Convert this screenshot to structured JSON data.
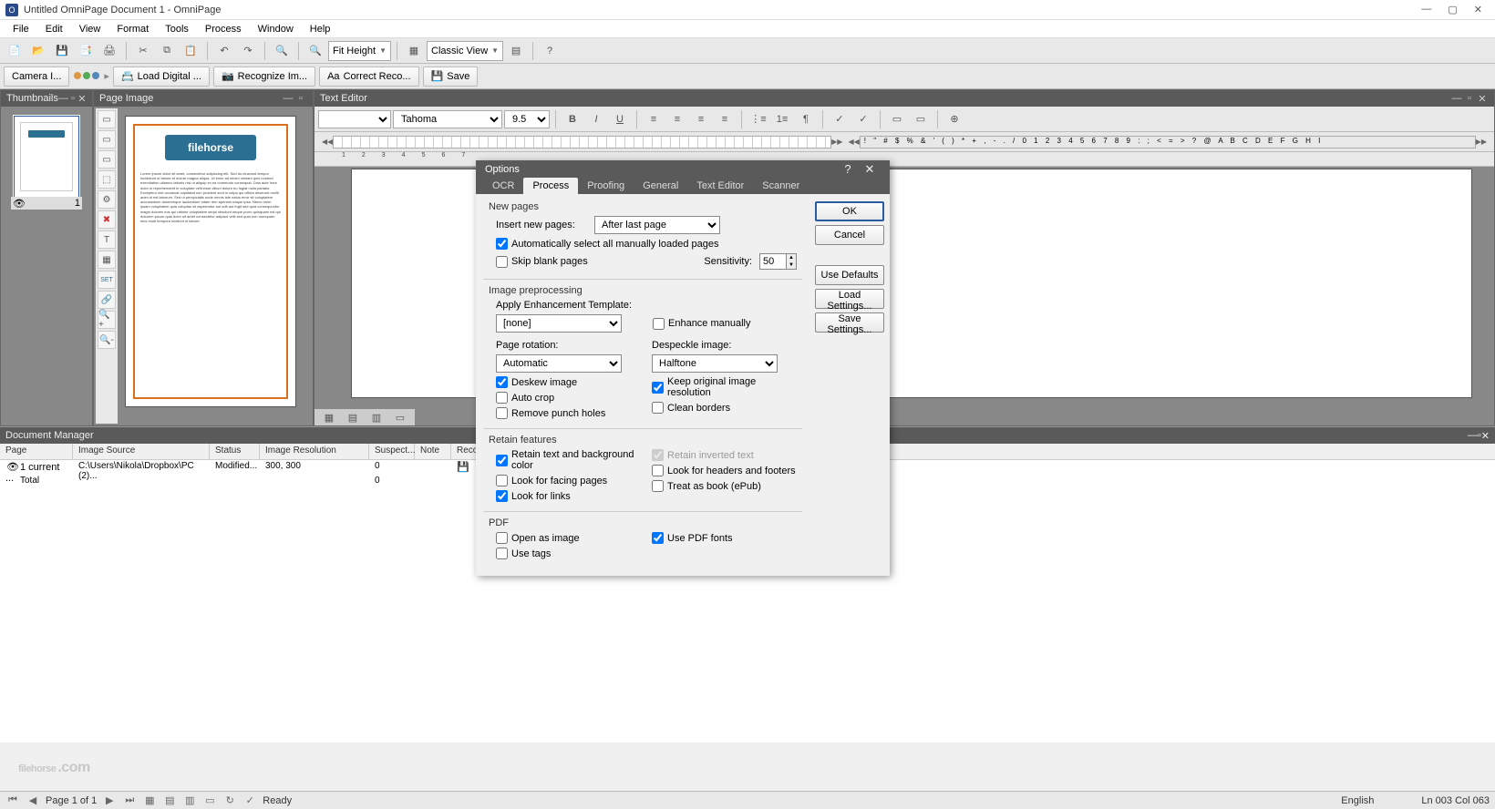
{
  "title": "Untitled OmniPage Document 1 - OmniPage",
  "menu": [
    "File",
    "Edit",
    "View",
    "Format",
    "Tools",
    "Process",
    "Window",
    "Help"
  ],
  "toolbar": {
    "fit_label": "Fit Height",
    "view_label": "Classic View"
  },
  "workflow": {
    "camera": "Camera I...",
    "load": "Load Digital ...",
    "recognize": "Recognize Im...",
    "correct": "Correct Reco...",
    "save": "Save"
  },
  "panels": {
    "thumbnails": "Thumbnails",
    "pageimage": "Page Image",
    "texteditor": "Text Editor",
    "docmgr": "Document Manager"
  },
  "editor": {
    "font": "Tahoma",
    "size": "9.5"
  },
  "docmgr": {
    "cols": [
      "Page",
      "Image Source",
      "Status",
      "Image Resolution",
      "Suspect...",
      "Note",
      "Recog..."
    ],
    "row1": {
      "page": "1 current ...",
      "src": "C:\\Users\\Nikola\\Dropbox\\PC (2)...",
      "status": "Modified...",
      "res": "300, 300",
      "suspect": "0"
    },
    "row2": {
      "page": "Total",
      "suspect": "0"
    }
  },
  "dialog": {
    "title": "Options",
    "tabs": [
      "OCR",
      "Process",
      "Proofing",
      "General",
      "Text Editor",
      "Scanner"
    ],
    "active_tab": 1,
    "buttons": {
      "ok": "OK",
      "cancel": "Cancel",
      "defaults": "Use Defaults",
      "load": "Load Settings...",
      "save": "Save Settings..."
    },
    "newpages": {
      "title": "New pages",
      "insert_label": "Insert new pages:",
      "insert_value": "After last page",
      "auto_select": "Automatically select all manually loaded pages",
      "skip_blank": "Skip blank pages",
      "sensitivity_label": "Sensitivity:",
      "sensitivity_value": "50"
    },
    "preproc": {
      "title": "Image preprocessing",
      "template_label": "Apply Enhancement Template:",
      "template_value": "[none]",
      "enhance_manually": "Enhance manually",
      "rotation_label": "Page rotation:",
      "rotation_value": "Automatic",
      "despeckle_label": "Despeckle image:",
      "despeckle_value": "Halftone",
      "deskew": "Deskew image",
      "keep_res": "Keep original image resolution",
      "autocrop": "Auto crop",
      "clean_borders": "Clean borders",
      "punch": "Remove punch holes"
    },
    "retain": {
      "title": "Retain features",
      "text_bg": "Retain text and background color",
      "inverted": "Retain inverted text",
      "facing": "Look for facing pages",
      "headers": "Look for headers and footers",
      "links": "Look for links",
      "epub": "Treat as book (ePub)"
    },
    "pdf": {
      "title": "PDF",
      "open_image": "Open as image",
      "use_fonts": "Use PDF fonts",
      "use_tags": "Use tags"
    }
  },
  "statusbar": {
    "page": "Page 1 of 1",
    "ready": "Ready",
    "lang": "English",
    "pos": "Ln 003  Col 063"
  },
  "watermark": {
    "main": "filehorse",
    "suffix": ".com"
  }
}
